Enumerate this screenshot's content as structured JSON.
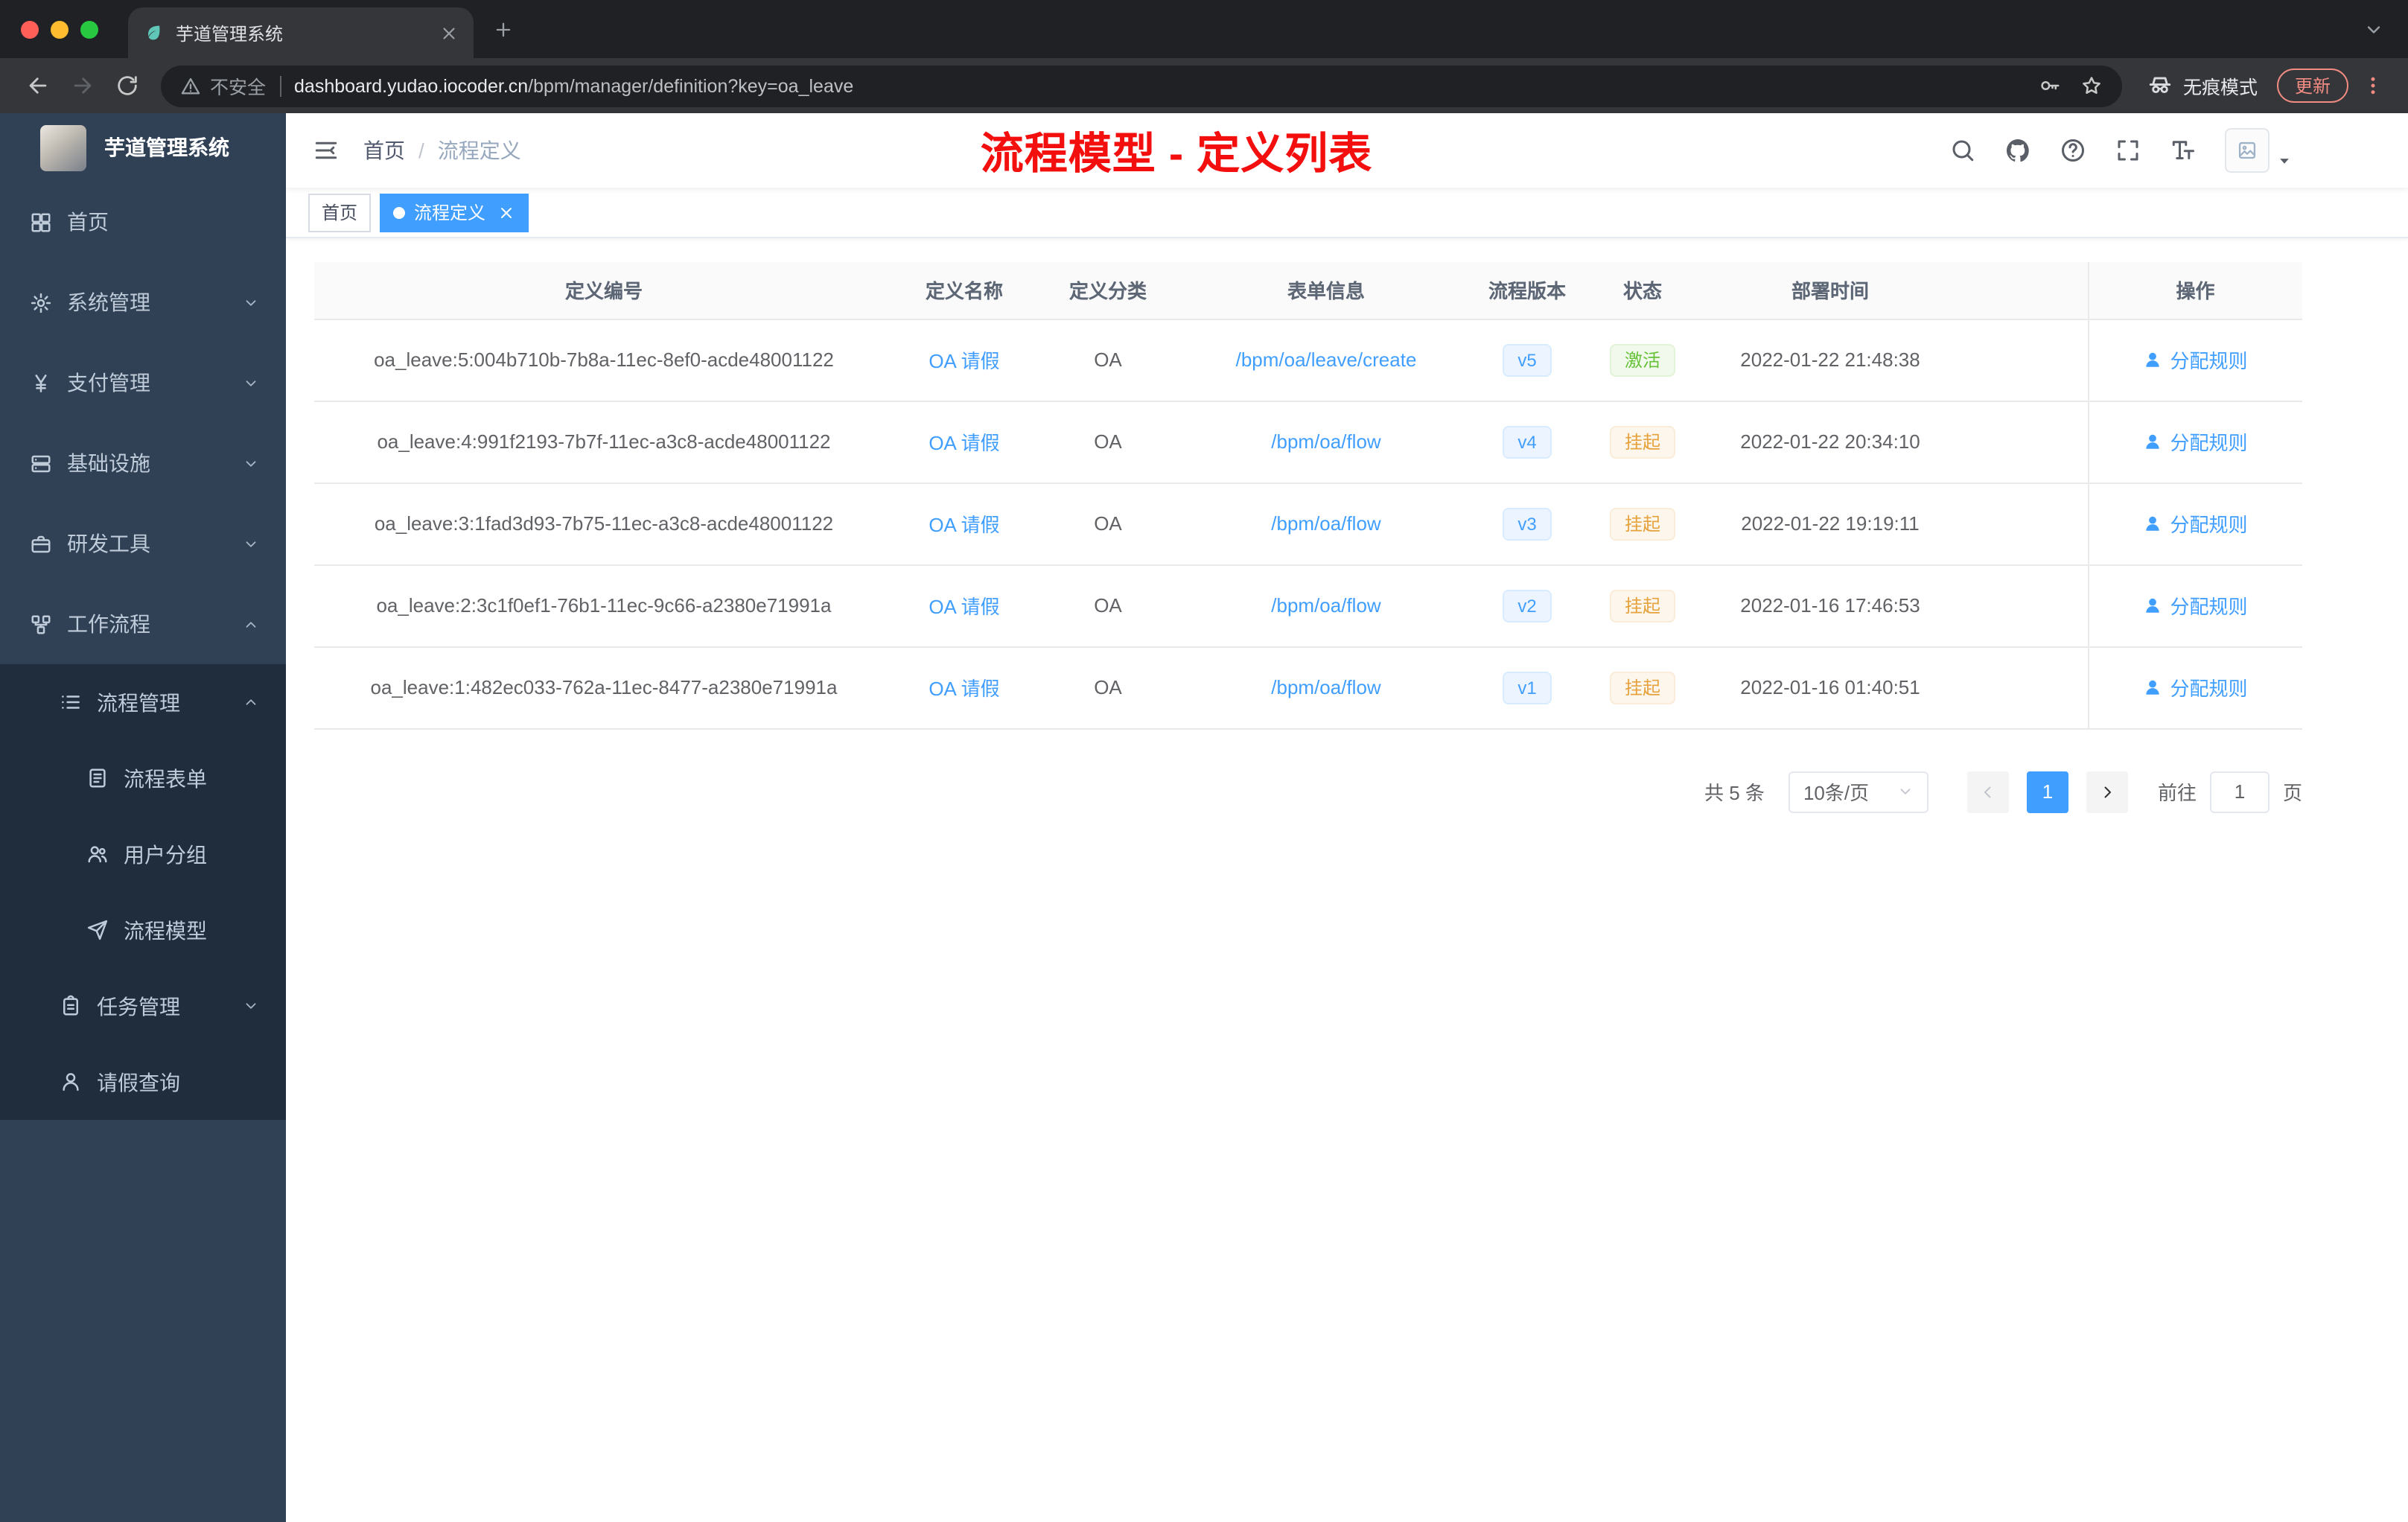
{
  "browser": {
    "tab_title": "芋道管理系统",
    "security_label": "不安全",
    "url_domain": "dashboard.yudao.iocoder.cn",
    "url_path": "/bpm/manager/definition?key=oa_leave",
    "incognito_label": "无痕模式",
    "update_label": "更新"
  },
  "sidebar": {
    "logo_title": "芋道管理系统",
    "menu": [
      {
        "key": "home",
        "label": "首页",
        "icon": "dashboard-icon",
        "level": 1,
        "chevron": ""
      },
      {
        "key": "system-manage",
        "label": "系统管理",
        "icon": "gear-icon",
        "level": 1,
        "chevron": "down"
      },
      {
        "key": "payment-manage",
        "label": "支付管理",
        "icon": "yen-icon",
        "level": 1,
        "chevron": "down"
      },
      {
        "key": "infrastructure",
        "label": "基础设施",
        "icon": "server-icon",
        "level": 1,
        "chevron": "down"
      },
      {
        "key": "dev-tools",
        "label": "研发工具",
        "icon": "briefcase-icon",
        "level": 1,
        "chevron": "down"
      },
      {
        "key": "workflow",
        "label": "工作流程",
        "icon": "workflow-icon",
        "level": 1,
        "chevron": "up"
      },
      {
        "key": "process-manage",
        "label": "流程管理",
        "icon": "list-icon",
        "level": 2,
        "chevron": "up"
      },
      {
        "key": "process-form",
        "label": "流程表单",
        "icon": "form-icon",
        "level": 3,
        "chevron": ""
      },
      {
        "key": "user-group",
        "label": "用户分组",
        "icon": "users-icon",
        "level": 3,
        "chevron": ""
      },
      {
        "key": "process-model",
        "label": "流程模型",
        "icon": "send-icon",
        "level": 3,
        "chevron": ""
      },
      {
        "key": "task-manage",
        "label": "任务管理",
        "icon": "clipboard-icon",
        "level": 2,
        "chevron": "down"
      },
      {
        "key": "leave-query",
        "label": "请假查询",
        "icon": "user-icon",
        "level": 2,
        "chevron": ""
      }
    ]
  },
  "header": {
    "breadcrumb": {
      "home": "首页",
      "separator": "/",
      "current": "流程定义"
    },
    "annotation": "流程模型 - 定义列表"
  },
  "tags": {
    "inactive": "首页",
    "active": "流程定义"
  },
  "table": {
    "columns": [
      "定义编号",
      "定义名称",
      "定义分类",
      "表单信息",
      "流程版本",
      "状态",
      "部署时间",
      "操作"
    ],
    "action_label": "分配规则",
    "rows": [
      {
        "id": "oa_leave:5:004b710b-7b8a-11ec-8ef0-acde48001122",
        "name": "OA 请假",
        "category": "OA",
        "form": "/bpm/oa/leave/create",
        "version": "v5",
        "status": "激活",
        "status_type": "success",
        "deployed_at": "2022-01-22 21:48:38"
      },
      {
        "id": "oa_leave:4:991f2193-7b7f-11ec-a3c8-acde48001122",
        "name": "OA 请假",
        "category": "OA",
        "form": "/bpm/oa/flow",
        "version": "v4",
        "status": "挂起",
        "status_type": "warning",
        "deployed_at": "2022-01-22 20:34:10"
      },
      {
        "id": "oa_leave:3:1fad3d93-7b75-11ec-a3c8-acde48001122",
        "name": "OA 请假",
        "category": "OA",
        "form": "/bpm/oa/flow",
        "version": "v3",
        "status": "挂起",
        "status_type": "warning",
        "deployed_at": "2022-01-22 19:19:11"
      },
      {
        "id": "oa_leave:2:3c1f0ef1-76b1-11ec-9c66-a2380e71991a",
        "name": "OA 请假",
        "category": "OA",
        "form": "/bpm/oa/flow",
        "version": "v2",
        "status": "挂起",
        "status_type": "warning",
        "deployed_at": "2022-01-16 17:46:53"
      },
      {
        "id": "oa_leave:1:482ec033-762a-11ec-8477-a2380e71991a",
        "name": "OA 请假",
        "category": "OA",
        "form": "/bpm/oa/flow",
        "version": "v1",
        "status": "挂起",
        "status_type": "warning",
        "deployed_at": "2022-01-16 01:40:51"
      }
    ]
  },
  "pagination": {
    "total": "共 5 条",
    "page_size": "10条/页",
    "current_page": "1",
    "goto_label": "前往",
    "goto_value": "1",
    "page_unit": "页"
  },
  "colors": {
    "primary": "#409eff",
    "success": "#67c23a",
    "warning": "#e6a23c",
    "annotation_red": "#f40f0f",
    "sidebar_bg": "#304156",
    "submenu_bg": "#1f2d3d",
    "chrome_dark": "#202124",
    "chrome_toolbar": "#35363a"
  }
}
